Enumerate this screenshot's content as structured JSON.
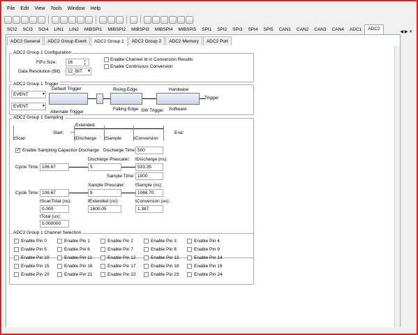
{
  "menu": [
    "File",
    "Edit",
    "View",
    "Tools",
    "Window",
    "Help"
  ],
  "top_tabs": [
    "SCI2",
    "SCI3",
    "SCI4",
    "LIN1",
    "LIN2",
    "MIBSPI1",
    "MIBSPI2",
    "MIBSPI3",
    "MIBSPI4",
    "MIBSPI5",
    "SPI1",
    "SPI2",
    "SPI3",
    "SPI4",
    "SPI5",
    "CAN1",
    "CAN2",
    "CAN3",
    "CAN4",
    "ADC1",
    "ADC2"
  ],
  "top_active": "ADC2",
  "sub_tabs": [
    "ADC2 General",
    "ADC2 Group Event",
    "ADC2 Group 1",
    "ADC2 Group 2",
    "ADC2 Memory",
    "ADC2 Port"
  ],
  "sub_active": "ADC2 Group 1",
  "config": {
    "title": "ADC2 Group 1 Configuration",
    "fifo_label": "FiFo Size:",
    "fifo_value": "16",
    "res_label": "Data Resolution (Bit):",
    "res_value": "12_BIT",
    "chk1": "Enable Channel Id in Conversion Results",
    "chk2": "Enable Continuous Conversion"
  },
  "trigger": {
    "title": "ADC2 Group 1 Trigger",
    "sel1": "EVENT",
    "sel2": "EVENT",
    "default": "Default Trigger",
    "alternate": "Alternate Trigger",
    "rising": "Rising Edge",
    "falling": "Falling Edge",
    "hardware": "Hardware",
    "software": "Software",
    "sw": "SW Trigger",
    "out": "Trigger"
  },
  "sampling": {
    "title": "ADC2 Group 1 Sampling",
    "start": "Start:",
    "end": "End:",
    "extended": "Extended",
    "tscan": "tScan",
    "tdischarge": "tDischarge",
    "tsample": "tSample",
    "tconversion": "tConversion",
    "enable_discharge": "Enable Sampling Capacitor Discharge",
    "discharge_time_label": "Discharge Time:",
    "discharge_time": "500",
    "cycle1_label": "Cycle Time:",
    "cycle1": "106.67",
    "dis_presc_label": "Discharge Prescaler:",
    "dis_presc": "5",
    "tdis_ns_label": "tDischarge (ns):",
    "tdis_ns": "533.35",
    "sample_time_label": "Sample Time:",
    "sample_time": "1000",
    "cycle2_label": "Cycle Time:",
    "cycle2": "106.67",
    "samp_presc_label": "Sample Prescaler:",
    "samp_presc": "8",
    "tsamp_ns_label": "tSample (ns):",
    "tsamp_ns": "1066.70",
    "tscantotal_label": "tScanTotal (ns):",
    "tscantotal": "0.000",
    "textended_label": "tExtended (ns):",
    "textended": "1600.05",
    "tconv_label": "tConversion (us):",
    "tconv": "1.387",
    "ttotal_label": "tTotal (us):",
    "ttotal": "0.000000"
  },
  "channels": {
    "title": "ADC2 Group 1 Channel Selection",
    "pins": [
      "Enable Pin 0",
      "Enable Pin 1",
      "Enable Pin 2",
      "Enable Pin 3",
      "Enable Pin 4",
      "Enable Pin 5",
      "Enable Pin 6",
      "Enable Pin 7",
      "Enable Pin 8",
      "Enable Pin 9",
      "Enable Pin 10",
      "Enable Pin 11",
      "Enable Pin 12",
      "Enable Pin 13",
      "Enable Pin 14",
      "Enable Pin 15",
      "Enable Pin 16",
      "Enable Pin 17",
      "Enable Pin 18",
      "Enable Pin 19",
      "Enable Pin 20",
      "Enable Pin 21",
      "Enable Pin 22",
      "Enable Pin 23",
      "Enable Pin 24"
    ]
  }
}
